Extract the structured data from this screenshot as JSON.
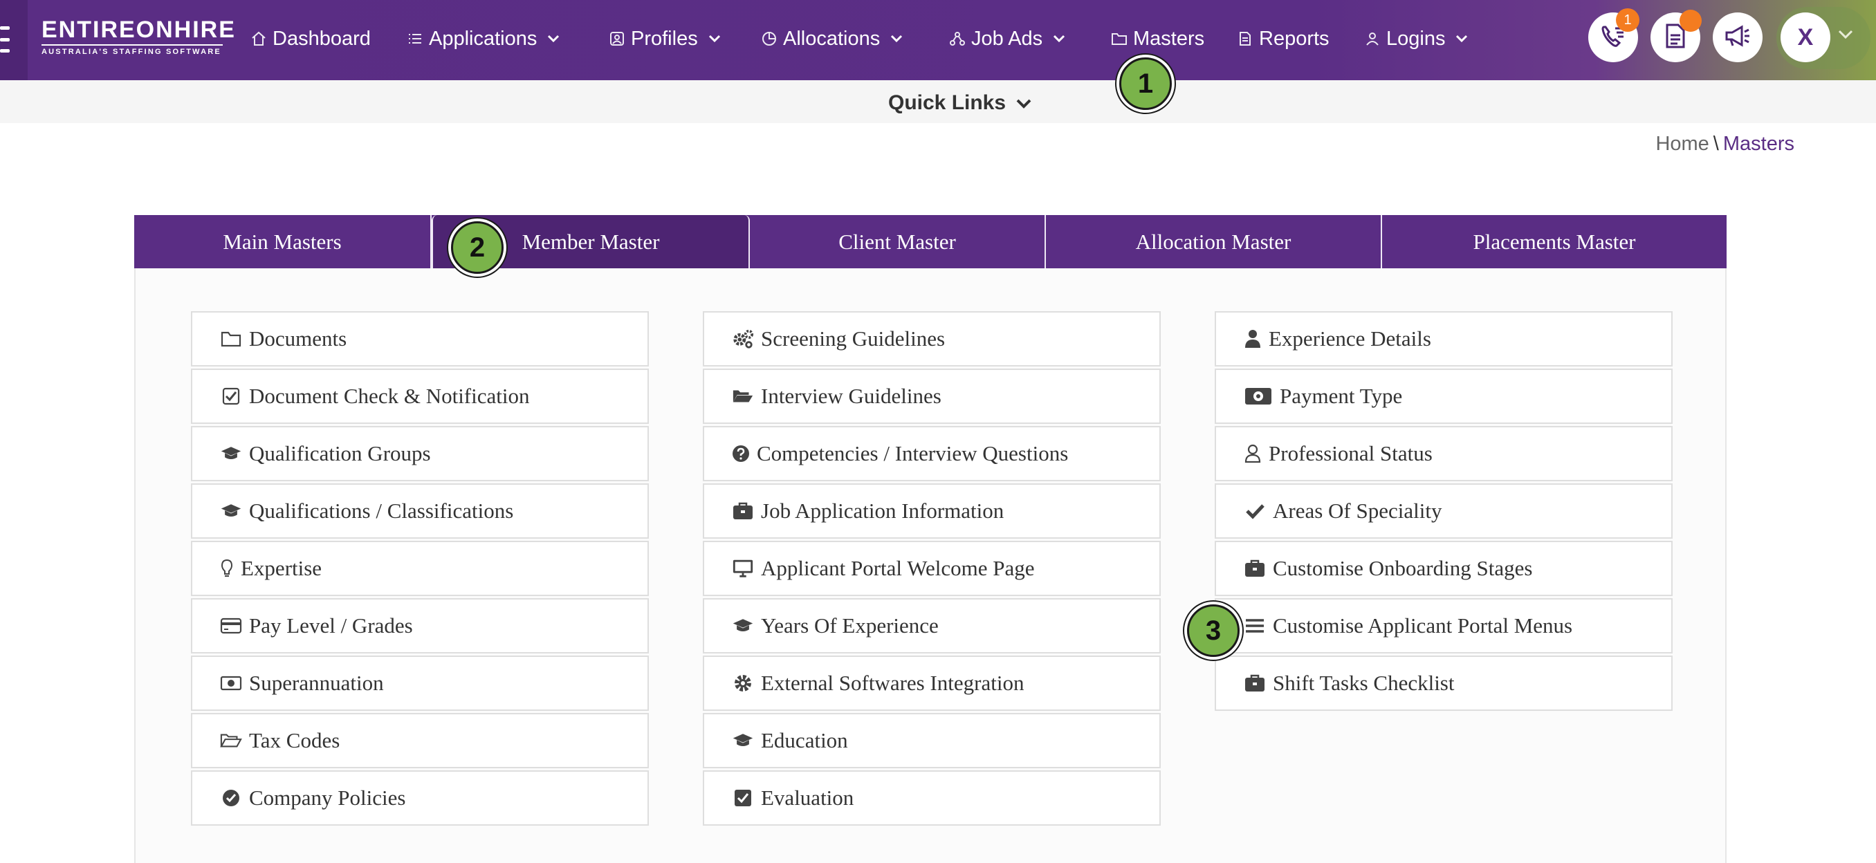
{
  "app": {
    "logo_text": "ENTIREONHIRE",
    "logo_tagline": "AUSTRALIA'S STAFFING SOFTWARE"
  },
  "nav": {
    "dashboard": "Dashboard",
    "applications": "Applications",
    "profiles": "Profiles",
    "allocations": "Allocations",
    "job_ads": "Job Ads",
    "masters": "Masters",
    "reports": "Reports",
    "logins": "Logins"
  },
  "header_actions": {
    "calls_badge": "1",
    "avatar_letter": "X",
    "accent_color": "#f47c20"
  },
  "quick_links": {
    "label": "Quick Links"
  },
  "breadcrumb": {
    "home": "Home",
    "separator": "\\",
    "current": "Masters"
  },
  "tabs": [
    "Main Masters",
    "Member Master",
    "Client Master",
    "Allocation Master",
    "Placements Master"
  ],
  "active_tab": "Member Master",
  "columns": [
    [
      {
        "label": "Documents",
        "icon": "folder-icon"
      },
      {
        "label": "Document Check & Notification",
        "icon": "check-square-icon"
      },
      {
        "label": "Qualification Groups",
        "icon": "graduation-cap-icon"
      },
      {
        "label": "Qualifications / Classifications",
        "icon": "graduation-cap-icon"
      },
      {
        "label": "Expertise",
        "icon": "lightbulb-icon"
      },
      {
        "label": "Pay Level / Grades",
        "icon": "credit-card-icon"
      },
      {
        "label": "Superannuation",
        "icon": "money-icon"
      },
      {
        "label": "Tax Codes",
        "icon": "folder-open-icon"
      },
      {
        "label": "Company Policies",
        "icon": "check-circle-icon"
      }
    ],
    [
      {
        "label": "Screening Guidelines",
        "icon": "cogs-icon"
      },
      {
        "label": "Interview Guidelines",
        "icon": "folder-open-solid-icon"
      },
      {
        "label": "Competencies / Interview Questions",
        "icon": "question-circle-icon"
      },
      {
        "label": "Job Application Information",
        "icon": "briefcase-icon"
      },
      {
        "label": "Applicant Portal Welcome Page",
        "icon": "desktop-icon"
      },
      {
        "label": "Years Of Experience",
        "icon": "graduation-cap-icon"
      },
      {
        "label": "External Softwares Integration",
        "icon": "gear-icon"
      },
      {
        "label": "Education",
        "icon": "graduation-cap-icon"
      },
      {
        "label": "Evaluation",
        "icon": "check-square-solid-icon"
      }
    ],
    [
      {
        "label": "Experience Details",
        "icon": "user-icon"
      },
      {
        "label": "Payment Type",
        "icon": "money-solid-icon"
      },
      {
        "label": "Professional Status",
        "icon": "user-outline-icon"
      },
      {
        "label": "Areas Of Speciality",
        "icon": "check-icon"
      },
      {
        "label": "Customise Onboarding Stages",
        "icon": "briefcase-icon"
      },
      {
        "label": "Customise Applicant Portal Menus",
        "icon": "bars-icon"
      },
      {
        "label": "Shift Tasks Checklist",
        "icon": "briefcase-icon"
      }
    ]
  ],
  "markers": [
    "1",
    "2",
    "3"
  ]
}
